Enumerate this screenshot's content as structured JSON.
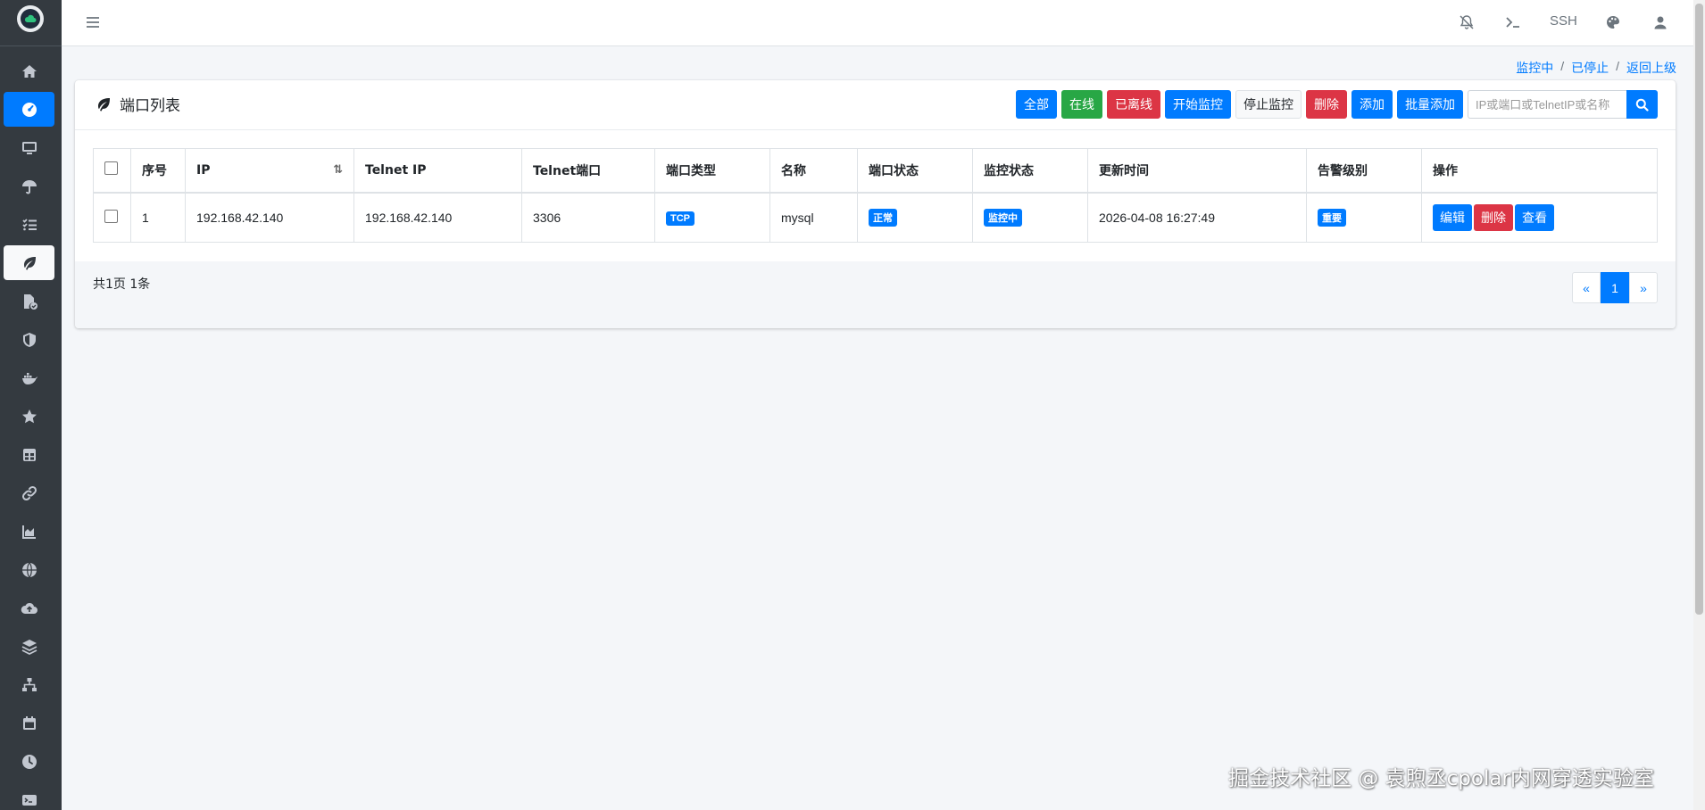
{
  "navbar": {
    "ssh_label": "SSH"
  },
  "breadcrumb": {
    "items": [
      "监控中",
      "已停止",
      "返回上级"
    ],
    "separator": "/"
  },
  "card": {
    "title": "端口列表",
    "toolbar": {
      "all": "全部",
      "online": "在线",
      "offline": "已离线",
      "start_monitor": "开始监控",
      "stop_monitor": "停止监控",
      "delete": "删除",
      "add": "添加",
      "batch_add": "批量添加",
      "search_placeholder": "IP或端口或TelnetIP或名称"
    }
  },
  "table": {
    "headers": [
      "序号",
      "IP",
      "Telnet IP",
      "Telnet端口",
      "端口类型",
      "名称",
      "端口状态",
      "监控状态",
      "更新时间",
      "告警级别",
      "操作"
    ],
    "rows": [
      {
        "index": "1",
        "ip": "192.168.42.140",
        "telnet_ip": "192.168.42.140",
        "telnet_port": "3306",
        "port_type": "TCP",
        "name": "mysql",
        "port_status": "正常",
        "monitor_status": "监控中",
        "updated": "2026-04-08 16:27:49",
        "alert_level": "重要",
        "actions": {
          "edit": "编辑",
          "delete": "删除",
          "view": "查看"
        }
      }
    ]
  },
  "footer": {
    "total": "共1页 1条",
    "pager": {
      "prev": "«",
      "current": "1",
      "next": "»"
    }
  },
  "watermark": "掘金技术社区 @ 袁煦丞cpolar内网穿透实验室",
  "colors": {
    "primary": "#007bff",
    "success": "#28a745",
    "danger": "#dc3545",
    "sidebar": "#343a40"
  }
}
